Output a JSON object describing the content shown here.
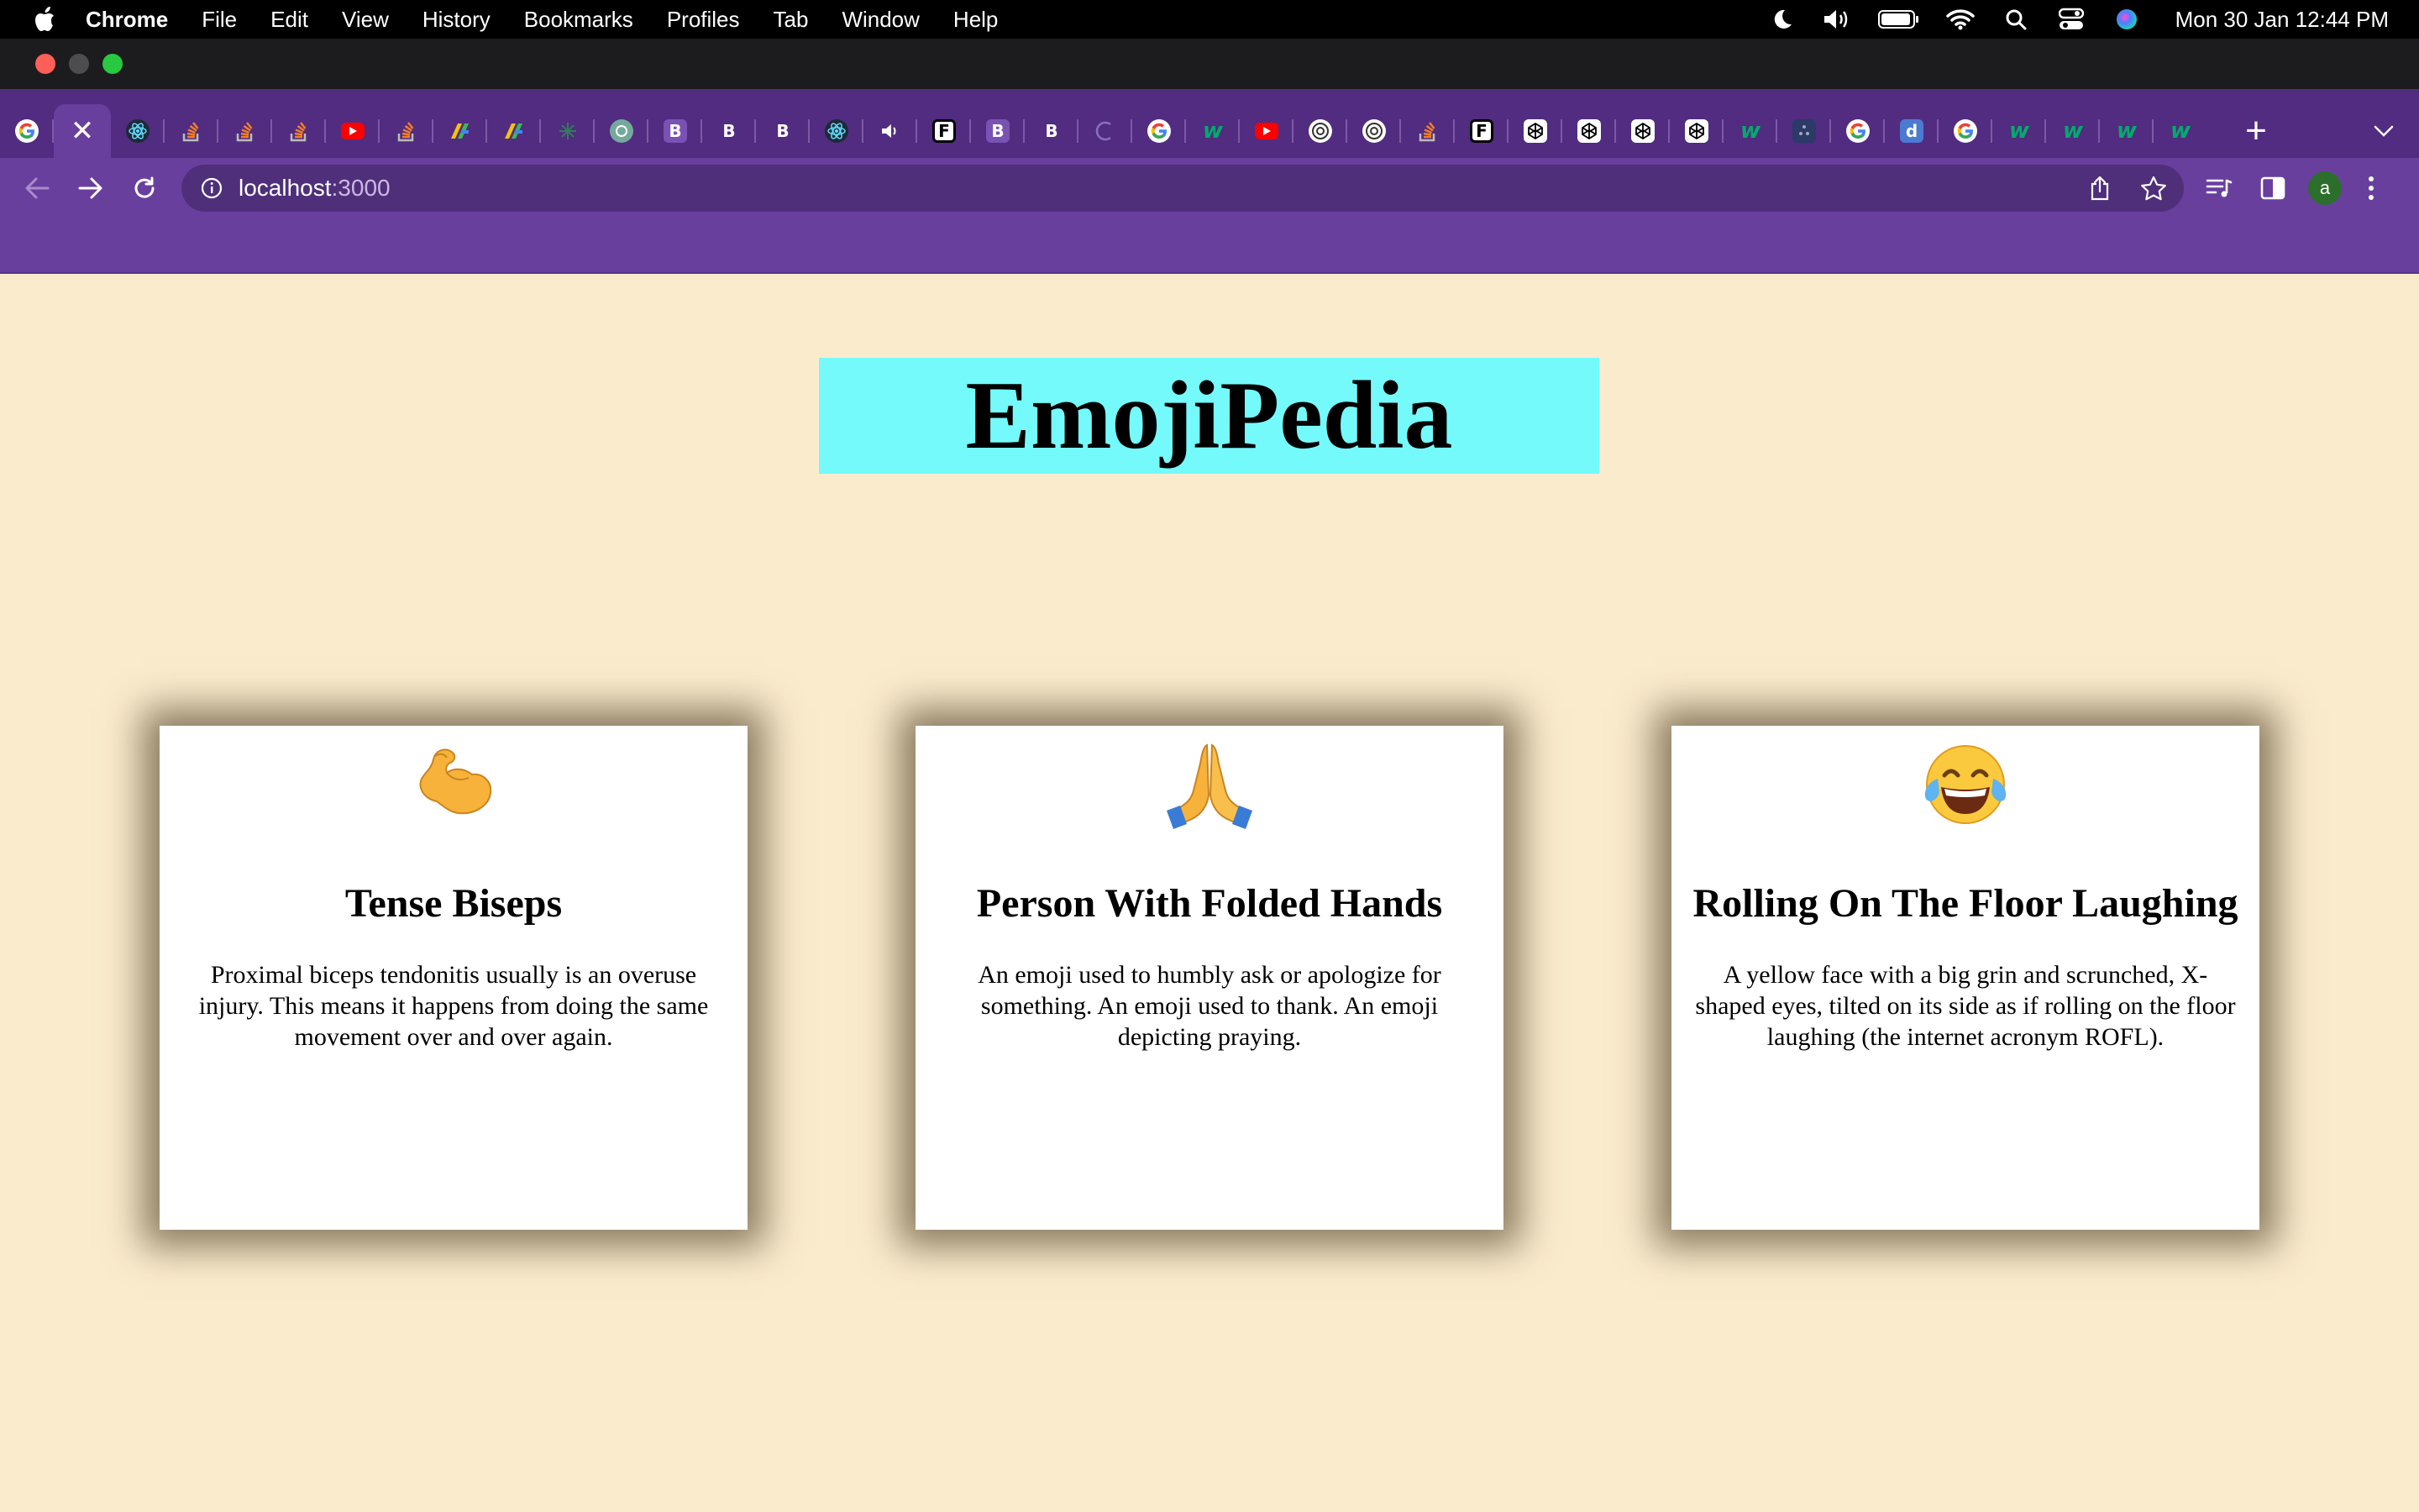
{
  "menubar": {
    "app_name": "Chrome",
    "items": [
      "File",
      "Edit",
      "View",
      "History",
      "Bookmarks",
      "Profiles",
      "Tab",
      "Window",
      "Help"
    ],
    "clock": "Mon 30 Jan  12:44 PM"
  },
  "tabs": {
    "items": [
      {
        "icon": "google-icon",
        "active": false
      },
      {
        "icon": "close-icon",
        "active": true
      },
      {
        "icon": "react-icon"
      },
      {
        "icon": "stackoverflow-icon"
      },
      {
        "icon": "stackoverflow-icon"
      },
      {
        "icon": "stackoverflow-icon"
      },
      {
        "icon": "youtube-icon"
      },
      {
        "icon": "stackoverflow-icon"
      },
      {
        "icon": "colorful-b-icon"
      },
      {
        "icon": "colorful-b-icon"
      },
      {
        "icon": "sparkle-icon"
      },
      {
        "icon": "chatgpt-icon"
      },
      {
        "icon": "bootstrap-icon",
        "letter": "B"
      },
      {
        "icon": "letter-b-icon",
        "letter": "B"
      },
      {
        "icon": "letter-b-icon",
        "letter": "B"
      },
      {
        "icon": "react-icon"
      },
      {
        "icon": "speaker-icon"
      },
      {
        "icon": "frontend-mentor-icon",
        "letter": "F"
      },
      {
        "icon": "bootstrap-icon",
        "letter": "B"
      },
      {
        "icon": "letter-b-icon",
        "letter": "B"
      },
      {
        "icon": "loading-icon"
      },
      {
        "icon": "google-icon"
      },
      {
        "icon": "w3-icon",
        "letter": "w"
      },
      {
        "icon": "youtube-icon"
      },
      {
        "icon": "globe-icon"
      },
      {
        "icon": "chrome-icon"
      },
      {
        "icon": "stackoverflow-icon"
      },
      {
        "icon": "frontend-mentor-icon",
        "letter": "F"
      },
      {
        "icon": "codepen-icon"
      },
      {
        "icon": "codepen-icon"
      },
      {
        "icon": "codepen-icon"
      },
      {
        "icon": "codepen-icon"
      },
      {
        "icon": "w3-icon",
        "letter": "w"
      },
      {
        "icon": "dots-icon"
      },
      {
        "icon": "google-icon"
      },
      {
        "icon": "d-icon",
        "letter": "d"
      },
      {
        "icon": "google-icon"
      },
      {
        "icon": "w3-icon",
        "letter": "w"
      },
      {
        "icon": "w3-icon",
        "letter": "w"
      },
      {
        "icon": "w3-icon",
        "letter": "w"
      },
      {
        "icon": "w3-icon",
        "letter": "w"
      }
    ],
    "new_tab_label": "+"
  },
  "toolbar": {
    "url_host": "localhost",
    "url_port": ":3000",
    "profile_initial": "a"
  },
  "page": {
    "title": "EmojiPedia",
    "cards": [
      {
        "emoji": "💪",
        "emoji_icon": "flexed-biceps-emoji",
        "name": "Tense Biseps",
        "description": "Proximal biceps tendonitis usually is an overuse injury. This means it happens from doing the same movement over and over again."
      },
      {
        "emoji": "🙏",
        "emoji_icon": "folded-hands-emoji",
        "name": "Person With Folded Hands",
        "description": "An emoji used to humbly ask or apologize for something. An emoji used to thank. An emoji depicting praying."
      },
      {
        "emoji": "😂",
        "emoji_icon": "tears-of-joy-emoji",
        "name": "Rolling On The Floor Laughing",
        "description": "A yellow face with a big grin and scrunched, X-shaped eyes, tilted on its side as if rolling on the floor laughing (the internet acronym ROFL)."
      }
    ]
  },
  "colors": {
    "page_background": "#fbebcd",
    "title_background": "#75fafc",
    "browser_frame": "#693f9e",
    "tabstrip": "#512c80"
  }
}
